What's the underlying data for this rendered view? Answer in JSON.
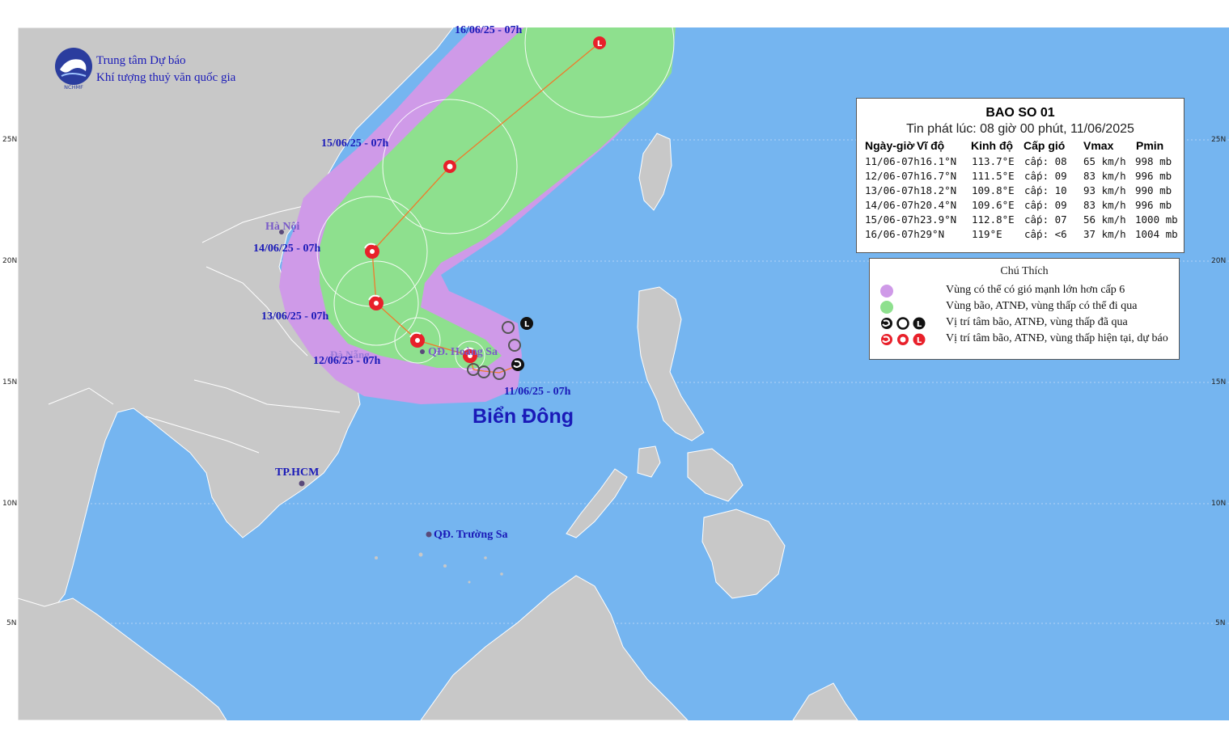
{
  "organization": {
    "line1": "Trung tâm Dự báo",
    "line2": "Khí tượng thuỷ văn quốc gia",
    "logo_text": "NCHMF",
    "logo_color": "#2b3d9e"
  },
  "storm_info": {
    "title": "BAO SO 01",
    "issued": "Tin phát lúc: 08 giờ 00 phút, 11/06/2025",
    "columns": [
      "Ngày-giờ",
      "Vĩ độ",
      "Kinh độ",
      "Cấp gió",
      "Vmax",
      "Pmin"
    ],
    "rows": [
      [
        "11/06-07h",
        "16.1°N",
        "113.7°E",
        "cấp: 08",
        "65 km/h",
        "998 mb"
      ],
      [
        "12/06-07h",
        "16.7°N",
        "111.5°E",
        "cấp: 09",
        "83 km/h",
        "996 mb"
      ],
      [
        "13/06-07h",
        "18.2°N",
        "109.8°E",
        "cấp: 10",
        "93 km/h",
        "990 mb"
      ],
      [
        "14/06-07h",
        "20.4°N",
        "109.6°E",
        "cấp: 09",
        "83 km/h",
        "996 mb"
      ],
      [
        "15/06-07h",
        "23.9°N",
        "112.8°E",
        "cấp: 07",
        "56 km/h",
        "1000 mb"
      ],
      [
        "16/06-07h",
        "29°N",
        "119°E",
        "cấp: <6",
        "37 km/h",
        "1004 mb"
      ]
    ]
  },
  "legend": {
    "title": "Chú Thích",
    "items": [
      {
        "text": "Vùng có thể có gió mạnh lớn hơn cấp 6",
        "color": "#cf9ae8"
      },
      {
        "text": "Vùng bão, ATNĐ, vùng thấp có thể đi qua",
        "color": "#8ee08e"
      },
      {
        "text": "Vị trí tâm bão, ATNĐ, vùng thấp đã qua",
        "color": "#111111"
      },
      {
        "text": "Vị trí tâm bão, ATNĐ, vùng thấp hiện tại, dự báo",
        "color": "#e8202a"
      }
    ]
  },
  "map_labels": {
    "cities": [
      {
        "name": "Hà Nội"
      },
      {
        "name": "Đà Nẵng"
      },
      {
        "name": "TP.HCM"
      }
    ],
    "islands": [
      {
        "name": "QĐ. Hoàng Sa"
      },
      {
        "name": "QĐ. Trường Sa"
      }
    ],
    "sea_name": "Biển Đông",
    "track_times": [
      "11/06/25 - 07h",
      "12/06/25 - 07h",
      "13/06/25 - 07h",
      "14/06/25 - 07h",
      "15/06/25 - 07h",
      "16/06/25 - 07h"
    ]
  },
  "latitude_ticks": [
    "25N",
    "20N",
    "15N",
    "10N",
    "5N"
  ],
  "colors": {
    "sea": "#75b5f0",
    "land": "#c8c8c8",
    "border": "#ffffff",
    "wind_zone": "#cf9ae8",
    "storm_zone": "#8ee08e",
    "track": "#f07a2a",
    "label": "#1a1ab8"
  }
}
